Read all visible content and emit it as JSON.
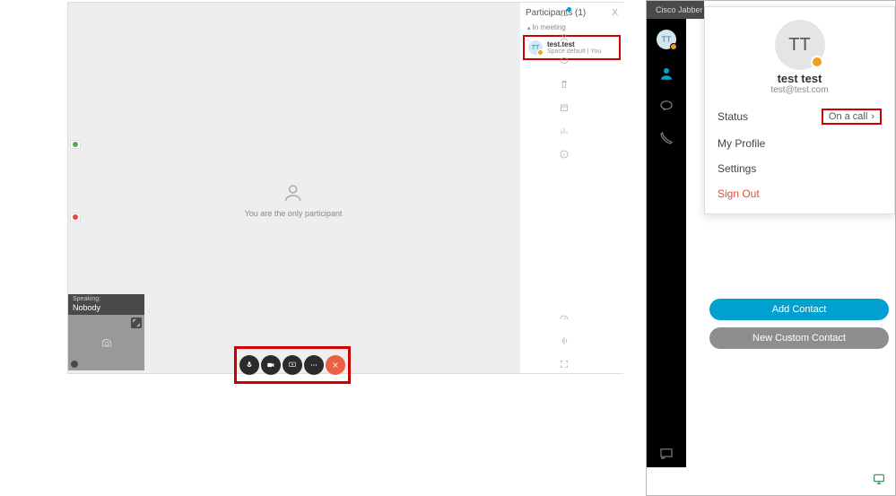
{
  "meeting": {
    "only_participant_msg": "You are the only participant",
    "speaking_label": "Speaking:",
    "speaking_value": "Nobody",
    "participants": {
      "title": "Participants (1)",
      "close": "X",
      "section_label": "In meeting",
      "items": [
        {
          "initials": "TT",
          "name": "test.test",
          "sub": "Space default | You"
        }
      ]
    }
  },
  "jabber": {
    "window_title": "Cisco Jabber",
    "avatar_initials": "TT",
    "profile": {
      "initials": "TT",
      "name": "test test",
      "email": "test@test.com",
      "status_label": "Status",
      "status_value": "On a call",
      "my_profile": "My Profile",
      "settings": "Settings",
      "sign_out": "Sign Out"
    },
    "buttons": {
      "add_contact": "Add Contact",
      "new_custom_contact": "New Custom Contact"
    }
  }
}
